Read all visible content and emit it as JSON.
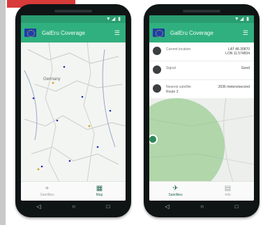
{
  "colors": {
    "status_bar": "#2a9c70",
    "app_bar": "#31b07f",
    "coverage_fill": "#80c174",
    "phone_body": "#0f1415",
    "flag_blue": "#1e3ea8"
  },
  "app": {
    "title": "GalEru Coverage",
    "status_icons": "▼◢ ▮"
  },
  "left_screen": {
    "map_label": "Germany",
    "nav": [
      {
        "icon": "map-pin-icon",
        "glyph": "⌖",
        "label": "Satellites",
        "active": false
      },
      {
        "icon": "map-icon",
        "glyph": "▦",
        "label": "Map",
        "active": true
      }
    ]
  },
  "right_screen": {
    "rows": [
      {
        "label": "Current location",
        "sub": "",
        "value": "LAT 48.30870\nLON 11.574834"
      },
      {
        "label": "Signal",
        "sub": "",
        "value": "Good"
      },
      {
        "label": "Nearest satellite",
        "sub": "Route 3",
        "value": "2036 meters/second"
      }
    ],
    "nav": [
      {
        "icon": "satellite-icon",
        "glyph": "✈",
        "label": "Satellites",
        "active": true
      },
      {
        "icon": "grid-icon",
        "glyph": "▤",
        "label": "Info",
        "active": false
      }
    ]
  },
  "system_nav": {
    "back": "◁",
    "home": "○",
    "recent": "□"
  }
}
